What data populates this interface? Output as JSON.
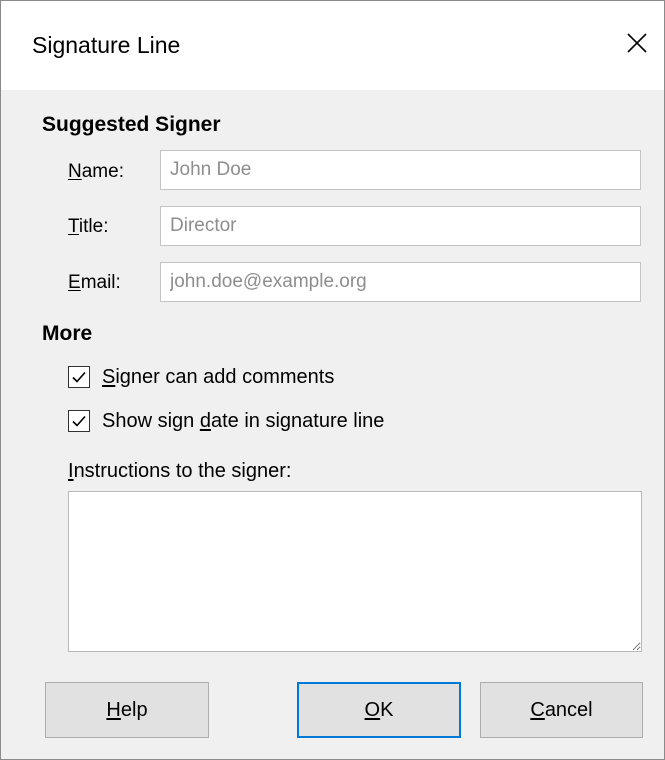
{
  "window": {
    "title": "Signature Line",
    "close_icon": "close-icon"
  },
  "suggested_signer": {
    "heading": "Suggested Signer",
    "name": {
      "label_mnemonic": "N",
      "label_rest": "ame:",
      "value": "John Doe"
    },
    "title": {
      "label_mnemonic": "T",
      "label_rest": "itle:",
      "value": "Director"
    },
    "email": {
      "label_mnemonic": "E",
      "label_rest": "mail:",
      "value": "john.doe@example.org"
    }
  },
  "more": {
    "heading": "More",
    "can_add_comments": {
      "checked": true,
      "label_mnemonic": "S",
      "label_rest": "igner can add comments"
    },
    "show_sign_date": {
      "checked": true,
      "label_before": "Show sign ",
      "label_mnemonic": "d",
      "label_rest": "ate in signature line"
    },
    "instructions": {
      "label_mnemonic": "I",
      "label_rest": "nstructions to the signer:",
      "value": ""
    }
  },
  "buttons": {
    "help": {
      "mnemonic": "H",
      "rest": "elp"
    },
    "ok": {
      "mnemonic": "O",
      "rest": "K"
    },
    "cancel": {
      "mnemonic": "C",
      "rest": "ancel"
    }
  },
  "colors": {
    "accent": "#0078d7",
    "dialog_background": "#f0f0f0",
    "placeholder_text": "#8e8e8e"
  }
}
